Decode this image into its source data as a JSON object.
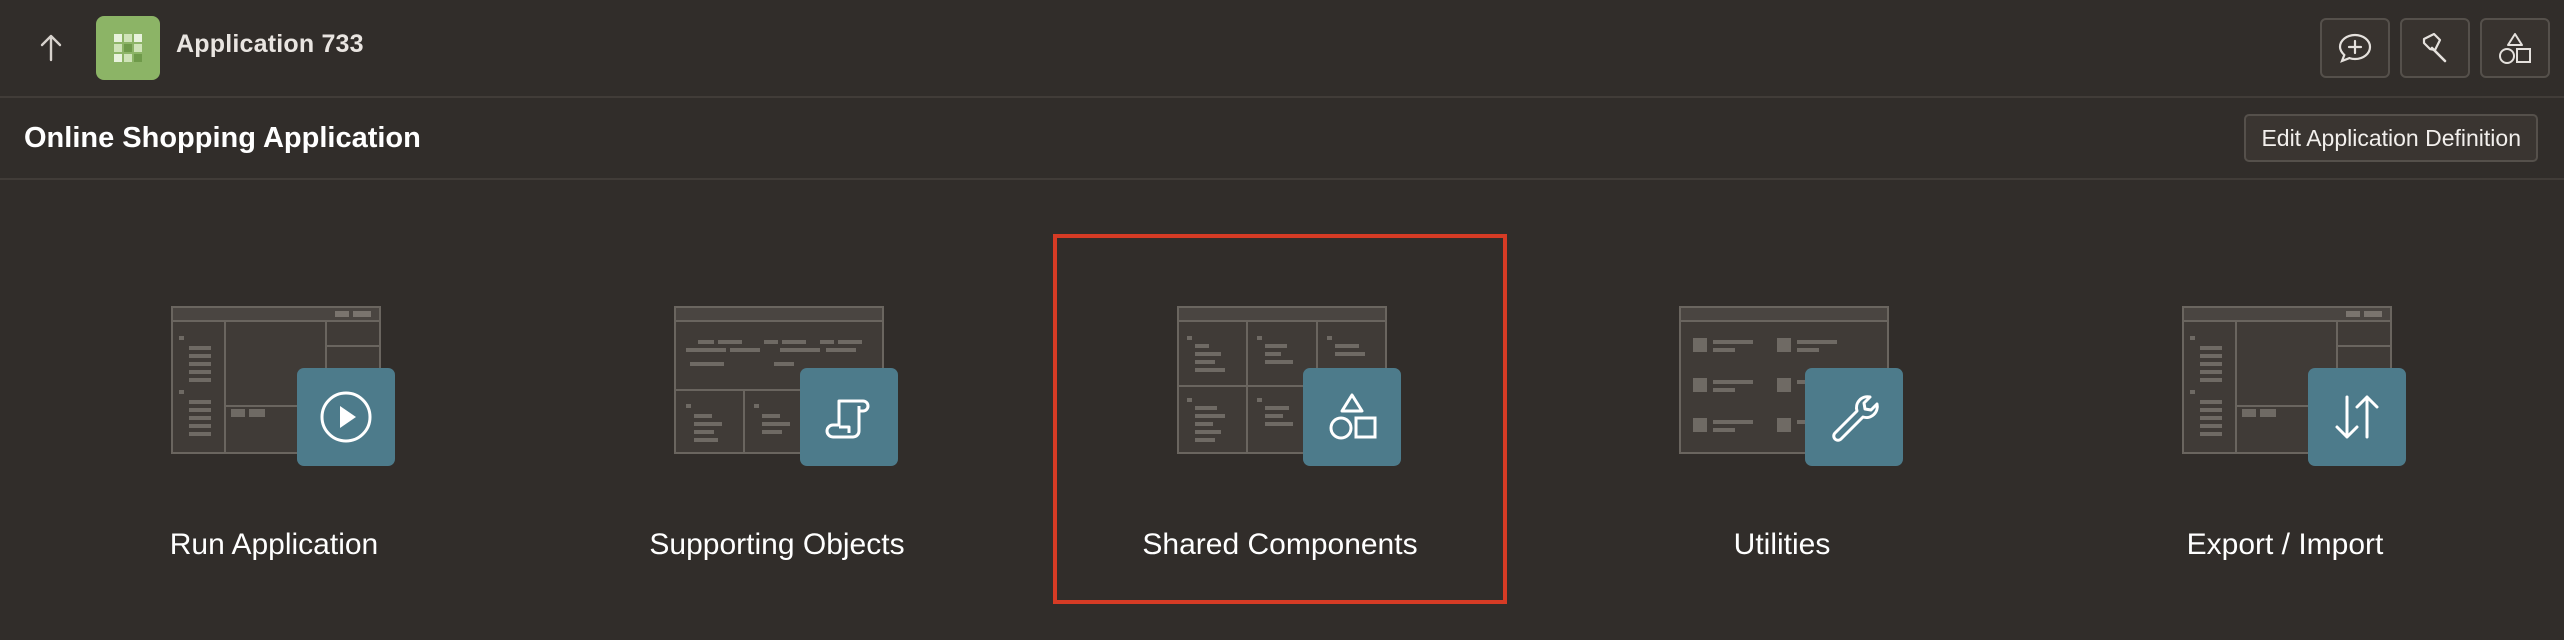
{
  "header": {
    "app_title": "Application 733",
    "icons": {
      "up": "arrow-up-icon",
      "logo": "grid-app-icon",
      "chat": "chat-add-icon",
      "flashlight": "flashlight-icon",
      "shapes": "shapes-icon"
    }
  },
  "subheader": {
    "page_title": "Online Shopping Application",
    "edit_button": "Edit Application Definition"
  },
  "tiles": [
    {
      "label": "Run Application",
      "icon": "play-icon"
    },
    {
      "label": "Supporting Objects",
      "icon": "scroll-icon"
    },
    {
      "label": "Shared Components",
      "icon": "shapes-icon",
      "selected": true
    },
    {
      "label": "Utilities",
      "icon": "wrench-icon"
    },
    {
      "label": "Export / Import",
      "icon": "up-down-arrows-icon"
    }
  ],
  "colors": {
    "background": "#312d2a",
    "badge": "#4d7b8b",
    "logo": "#8cb466",
    "highlight": "#d63b25"
  }
}
